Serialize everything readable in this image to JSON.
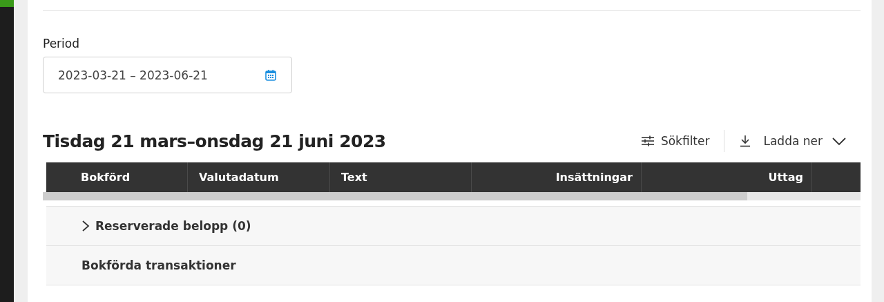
{
  "period": {
    "label": "Period",
    "value": "2023-03-21 – 2023-06-21"
  },
  "heading": "Tisdag 21 mars–onsdag 21 juni 2023",
  "actions": {
    "filter": "Sökfilter",
    "download": "Ladda ner"
  },
  "table": {
    "columns": [
      "Bokförd",
      "Valutadatum",
      "Text",
      "Insättningar",
      "Uttag"
    ],
    "groups": [
      {
        "kind": "expandable",
        "label": "Reserverade belopp (0)",
        "expanded": false
      },
      {
        "kind": "heading",
        "label": "Bokförda transaktioner"
      }
    ]
  }
}
